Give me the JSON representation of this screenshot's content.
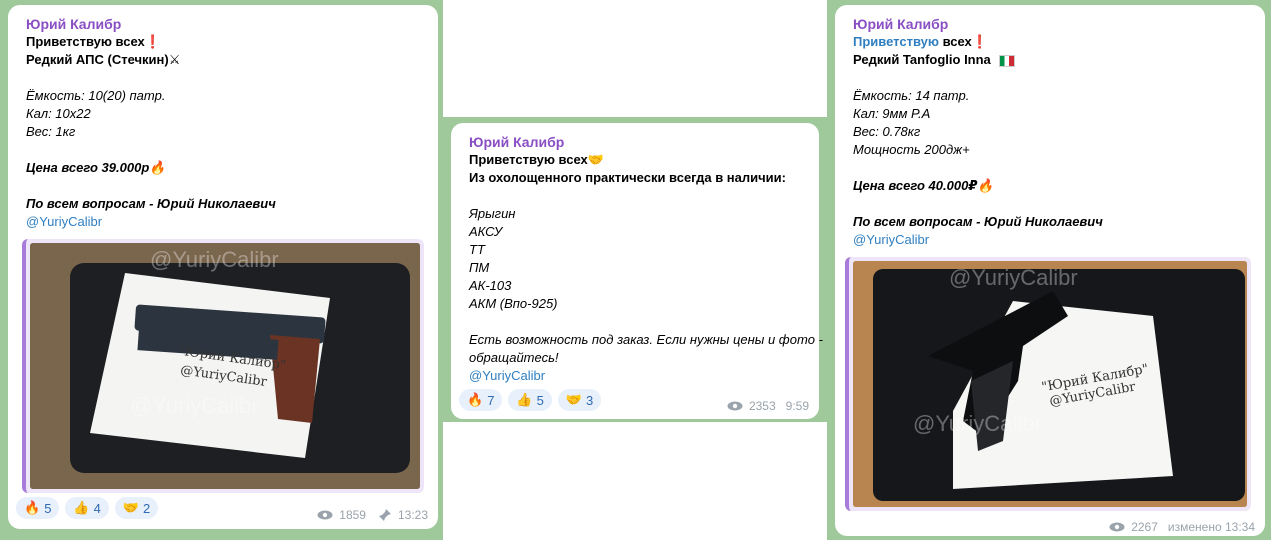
{
  "posts": [
    {
      "author": "Юрий Калибр",
      "line1": "Приветствую всех",
      "line1_emoji": "❗",
      "line2": "Редкий АПС (Стечкин)",
      "line2_emoji": "⚔",
      "spec1": "Ёмкость: 10(20) патр.",
      "spec2": "Кал: 10x22",
      "spec3": "Вес: 1кг",
      "price": "Цена всего 39.000р",
      "price_emoji": "🔥",
      "contact": "По всем вопросам - Юрий Николаевич",
      "handle": "@YuriyCalibr",
      "photo_watermark": "@YuriyCalibr",
      "photo_note1": "\"Юрий Калибр\"",
      "photo_note2": "@YuriyCalibr",
      "reactions": [
        {
          "emoji": "🔥",
          "count": "5"
        },
        {
          "emoji": "👍",
          "count": "4"
        },
        {
          "emoji": "🤝",
          "count": "2"
        }
      ],
      "views": "1859",
      "time": "13:23"
    },
    {
      "author": "Юрий Калибр",
      "line1": "Приветствую всех",
      "line1_emoji": "🤝",
      "line2": "Из охолощенного практически всегда в наличии:",
      "items": [
        "Ярыгин",
        "АКСУ",
        "ТТ",
        "ПМ",
        "АК-103",
        "АКМ (Впо-925)"
      ],
      "note1": "Есть возможность под заказ. Если нужны цены и фото -",
      "note2": "обращайтесь!",
      "handle": "@YuriyCalibr",
      "reactions": [
        {
          "emoji": "🔥",
          "count": "7"
        },
        {
          "emoji": "👍",
          "count": "5"
        },
        {
          "emoji": "🤝",
          "count": "3"
        }
      ],
      "views": "2353",
      "time": "9:59"
    },
    {
      "author": "Юрий Калибр",
      "line1_link": "Приветствую",
      "line1_rest": " всех",
      "line1_emoji": "❗",
      "line2": "Редкий Tanfoglio Inna",
      "spec1": "Ёмкость: 14 патр.",
      "spec2": "Кал: 9мм P.A",
      "spec3": "Вес: 0.78кг",
      "spec4": "Мощность 200дж+",
      "price": "Цена всего 40.000₽",
      "price_emoji": "🔥",
      "contact": "По всем вопросам - Юрий Николаевич",
      "handle": "@YuriyCalibr",
      "photo_watermark": "@YuriyCalibr",
      "photo_note1": "\"Юрий Калибр\"",
      "photo_note2": "@YuriyCalibr",
      "views": "2267",
      "time": "изменено 13:34"
    }
  ]
}
